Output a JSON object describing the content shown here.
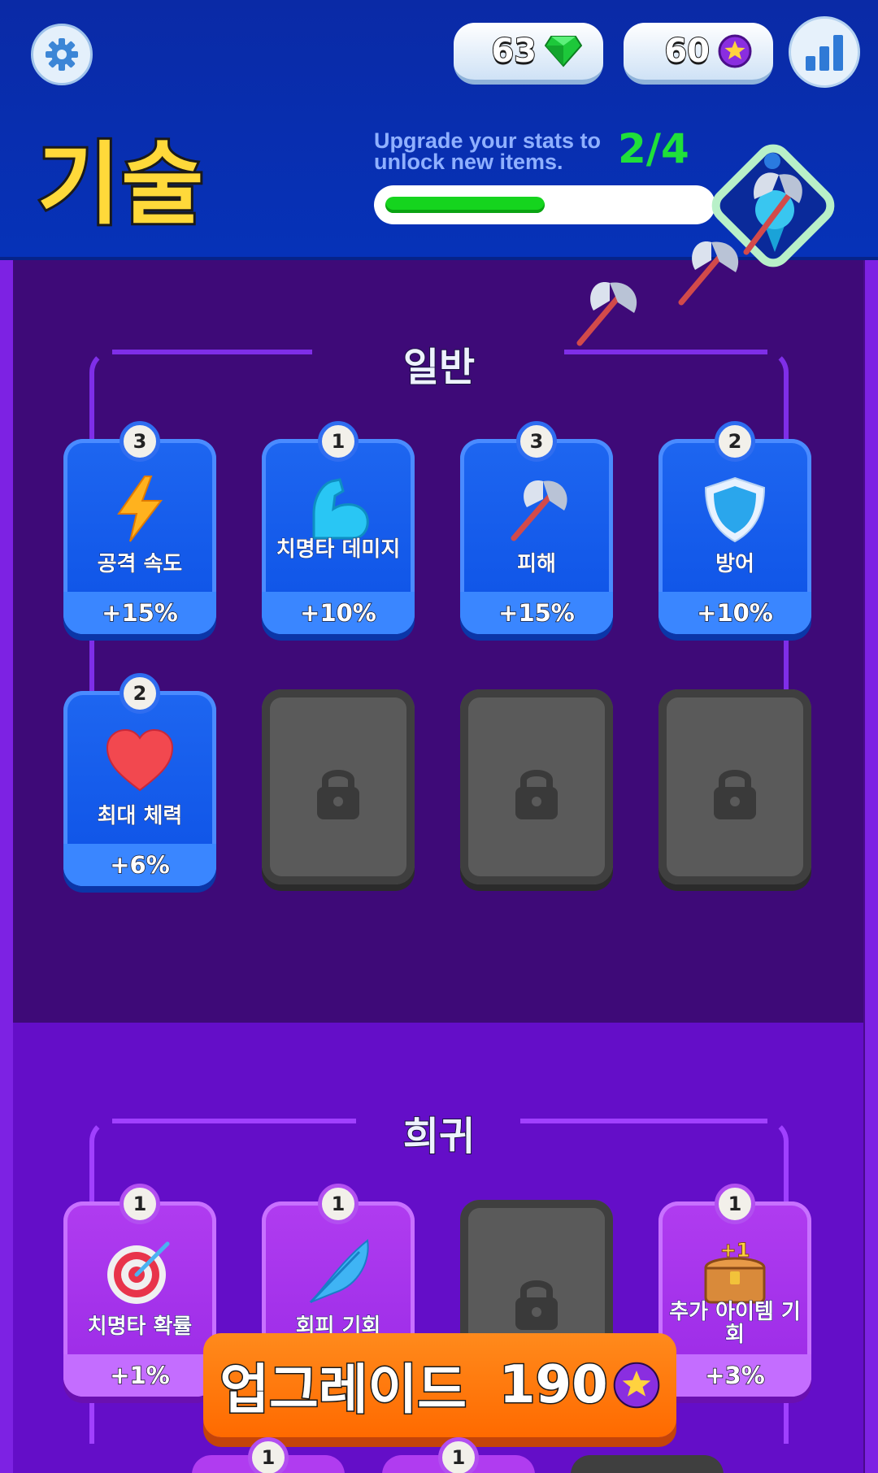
{
  "header": {
    "title": "기술",
    "currency_gems": "63",
    "currency_coins": "60",
    "hint": "Upgrade your stats to unlock new items.",
    "progress_text": "2/4",
    "progress_value": 0.5
  },
  "sections": {
    "common_title": "일반",
    "rare_title": "희귀"
  },
  "common_cards": [
    {
      "level": "3",
      "label": "공격 속도",
      "bonus": "+15%",
      "icon": "lightning-icon"
    },
    {
      "level": "1",
      "label": "치명타 데미지",
      "bonus": "+10%",
      "icon": "muscle-arm-icon"
    },
    {
      "level": "3",
      "label": "피해",
      "bonus": "+15%",
      "icon": "battle-axe-icon"
    },
    {
      "level": "2",
      "label": "방어",
      "bonus": "+10%",
      "icon": "shield-icon"
    },
    {
      "level": "2",
      "label": "최대 체력",
      "bonus": "+6%",
      "icon": "heart-icon"
    }
  ],
  "rare_cards": [
    {
      "level": "1",
      "label": "치명타 확률",
      "bonus": "+1%",
      "icon": "target-icon"
    },
    {
      "level": "1",
      "label": "회피 기회",
      "bonus": "",
      "icon": "feather-icon"
    },
    {
      "level": "1",
      "label": "추가 아이템 기회",
      "bonus": "+3%",
      "icon": "treasure-chest-icon"
    }
  ],
  "peek_levels": [
    "1",
    "1"
  ],
  "upgrade": {
    "label": "업그레이드",
    "cost": "190"
  },
  "colors": {
    "header_blue": "#0632b8",
    "common_card": "#1e66f0",
    "rare_card": "#b03cf0",
    "locked_card": "#5a5a5a",
    "upgrade_orange": "#ff7a10",
    "progress_green": "#15d41e",
    "title_yellow": "#ffd93a"
  }
}
